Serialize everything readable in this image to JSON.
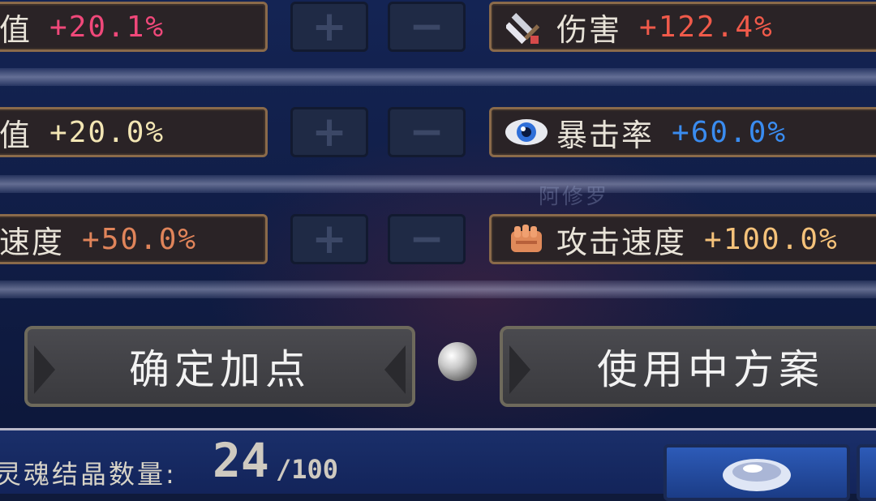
{
  "left_stats": [
    {
      "name": "值",
      "value": "+20.1%",
      "color": "#f0487a"
    },
    {
      "name": "值",
      "value": "+20.0%",
      "color": "#f3e6b4"
    },
    {
      "name": "速度",
      "value": "+50.0%",
      "color": "#e0845a"
    }
  ],
  "plus_label": "+",
  "minus_label": "−",
  "right_stats": [
    {
      "icon": "sword-icon",
      "name": "伤害",
      "value": "+122.4%",
      "color": "#f05a4a"
    },
    {
      "icon": "eye-icon",
      "name": "暴击率",
      "value": "+60.0%",
      "color": "#3a8cf0"
    },
    {
      "icon": "fist-icon",
      "name": "攻击速度",
      "value": "+100.0%",
      "color": "#f5c27a"
    }
  ],
  "confirm_button": "确定加点",
  "plan_button": "使用中方案",
  "bg_name": "阿修罗",
  "crystal": {
    "label": "灵魂结晶数量:",
    "count": "24",
    "max": "/100"
  }
}
